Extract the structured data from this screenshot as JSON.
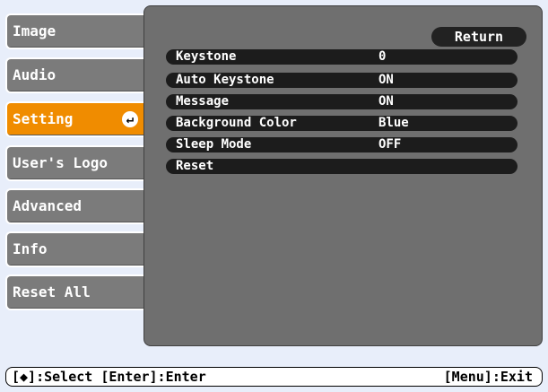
{
  "menu": {
    "items": [
      {
        "label": "Image"
      },
      {
        "label": "Audio"
      },
      {
        "label": "Setting",
        "selected": true
      },
      {
        "label": "User's Logo"
      },
      {
        "label": "Advanced"
      },
      {
        "label": "Info"
      },
      {
        "label": "Reset All"
      }
    ],
    "enter_icon_glyph": "↵"
  },
  "panel": {
    "return_label": "Return",
    "items": [
      {
        "label": "Keystone",
        "value": "0"
      },
      {
        "label": "Auto Keystone",
        "value": "ON"
      },
      {
        "label": "Message",
        "value": "ON"
      },
      {
        "label": "Background Color",
        "value": "Blue"
      },
      {
        "label": "Sleep Mode",
        "value": "OFF"
      },
      {
        "label": "Reset",
        "value": ""
      }
    ]
  },
  "helpbar": {
    "left_text": "[◆]:Select [Enter]:Enter",
    "right_text": "[Menu]:Exit"
  },
  "colors": {
    "selected_tab": "#f08c00",
    "tab": "#7b7b7b",
    "panel": "#6f6f6f",
    "background": "#e8eefa"
  }
}
